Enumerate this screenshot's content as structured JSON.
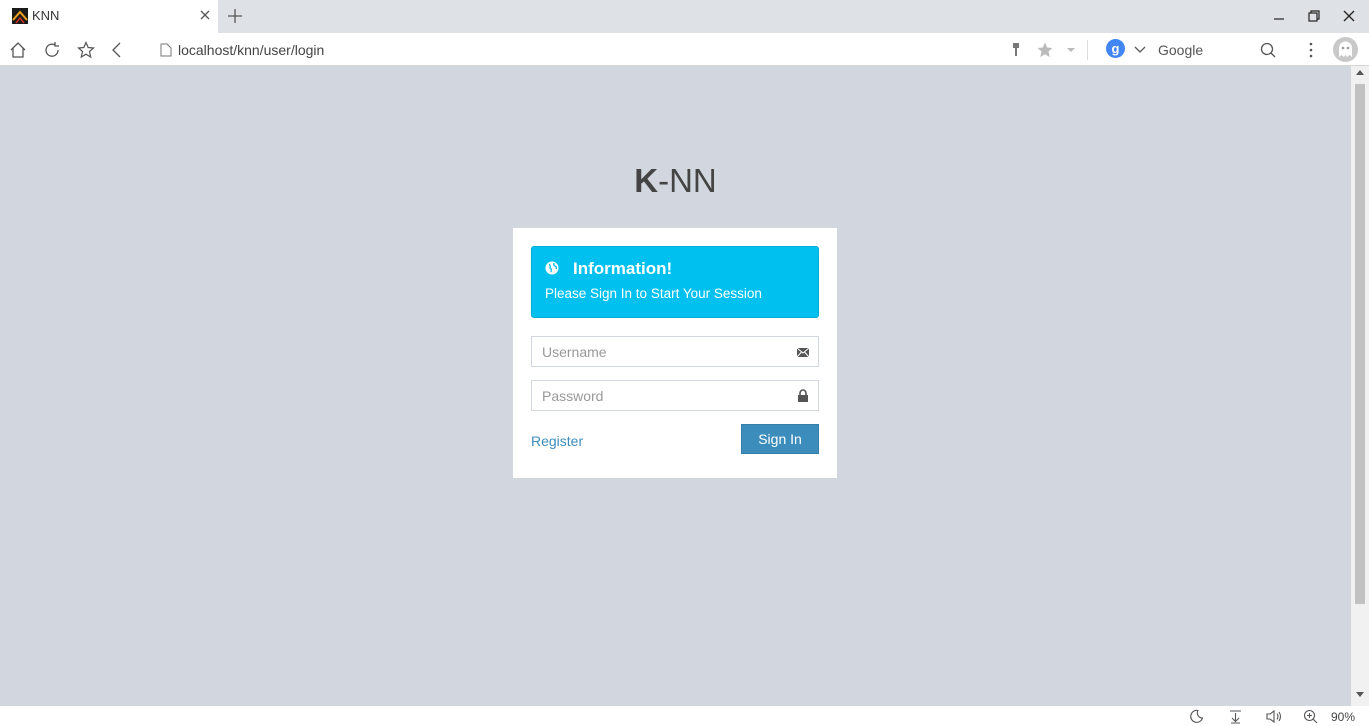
{
  "browser": {
    "tab_title": "KNN",
    "url": "localhost/knn/user/login",
    "search_engine": "Google",
    "search_badge": "g",
    "zoom": "90%"
  },
  "page": {
    "logo_bold": "K",
    "logo_rest": "-NN",
    "info": {
      "title": "Information!",
      "message": "Please Sign In to Start Your Session"
    },
    "username_placeholder": "Username",
    "password_placeholder": "Password",
    "register_label": "Register",
    "signin_label": "Sign In"
  },
  "colors": {
    "page_background": "#d2d6de",
    "info_background": "#00c0ef",
    "primary_button": "#3c8dbc",
    "link": "#3c8dbc"
  }
}
